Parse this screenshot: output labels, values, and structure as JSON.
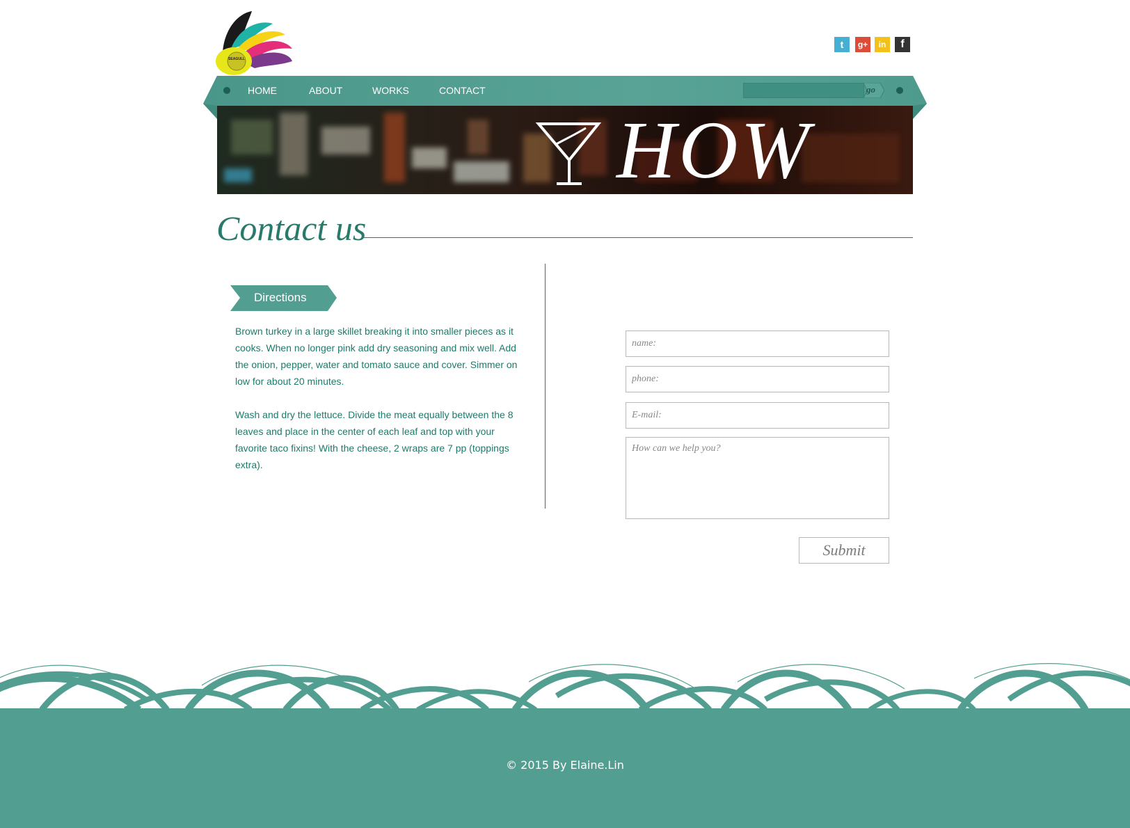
{
  "colors": {
    "teal": "#529f91",
    "dark_teal": "#2a7a6b",
    "text_teal": "#1d7a6a"
  },
  "logo": {
    "text": "SEAGULL",
    "icon": "seagull-feather-logo-icon"
  },
  "social": [
    {
      "name": "twitter",
      "glyph": "t",
      "icon": "twitter-icon"
    },
    {
      "name": "google-plus",
      "glyph": "g+",
      "icon": "google-plus-icon"
    },
    {
      "name": "linkedin",
      "glyph": "in",
      "icon": "linkedin-icon"
    },
    {
      "name": "facebook",
      "glyph": "f",
      "icon": "facebook-icon"
    }
  ],
  "nav": {
    "items": [
      "HOME",
      "ABOUT",
      "WORKS",
      "CONTACT"
    ]
  },
  "search": {
    "placeholder": "",
    "go_label": "go"
  },
  "banner": {
    "title": "HOW",
    "icon": "martini-glass-icon"
  },
  "page": {
    "title": "Contact us"
  },
  "directions": {
    "label": "Directions",
    "paragraphs": [
      "Brown turkey in a large skillet breaking it into smaller pieces as it cooks. When no longer pink add dry seasoning and mix well. Add the onion, pepper, water and tomato sauce and cover. Simmer on low for about 20 minutes.",
      "Wash and dry the lettuce. Divide the meat equally between the 8 leaves and place in the center of each leaf and top with your favorite taco fixins! With the cheese, 2 wraps are 7 pp (toppings extra)."
    ]
  },
  "form": {
    "name_placeholder": "name:",
    "phone_placeholder": "phone:",
    "email_placeholder": "E-mail:",
    "message_placeholder": "How can we help you?",
    "submit_label": "Submit"
  },
  "footer": {
    "copyright": "© 2015 By Elaine.Lin"
  }
}
